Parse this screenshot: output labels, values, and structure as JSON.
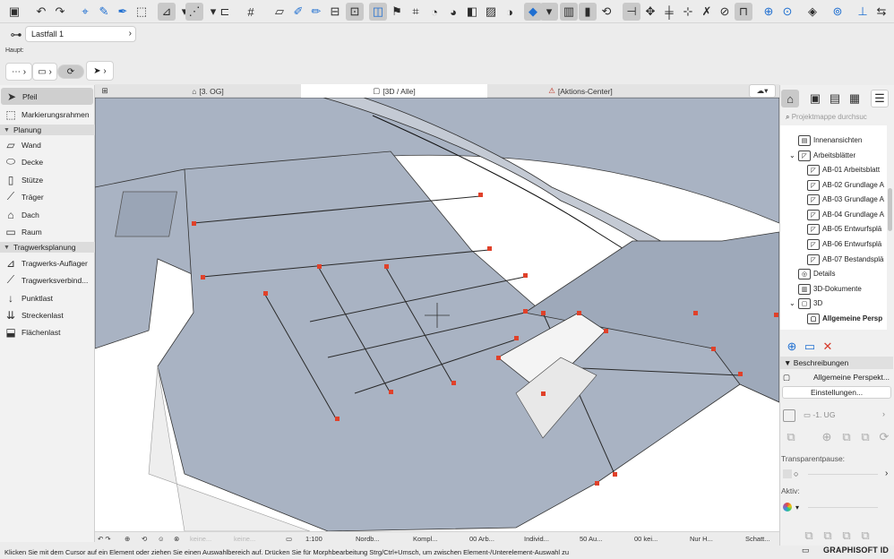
{
  "toolbar": {
    "icons": [
      "save-icon",
      "undo-icon",
      "redo-icon",
      "magic-wand-icon",
      "eyedropper-icon",
      "syringe-icon",
      "lasso-icon",
      "guide-lines-icon",
      "snap-icon",
      "grid-icon",
      "surface-icon",
      "pen-icon",
      "figure-icon",
      "select-box-icon",
      "flag-icon",
      "camera-icon",
      "render-icon",
      "trim-icon",
      "layers-icon",
      "picture-icon",
      "filter-icon",
      "column-icon",
      "view-icon",
      "scale-icon",
      "cut-icon",
      "rotate-icon",
      "mirror-icon",
      "explode-icon",
      "split-icon",
      "zoom-icon",
      "3d-icon",
      "cutaway-icon",
      "dimension-icon"
    ]
  },
  "lastfall": {
    "label": "Lastfall 1",
    "chevron": "›"
  },
  "infobox": {
    "haupt_label": "Haupt:"
  },
  "toolbox": {
    "items": [
      {
        "label": "Pfeil",
        "icon": "arrow-icon",
        "selected": true
      },
      {
        "label": "Markierungsrahmen",
        "icon": "marquee-icon"
      }
    ],
    "groups": [
      {
        "label": "Planung",
        "items": [
          "Wand",
          "Decke",
          "Stütze",
          "Träger",
          "Dach",
          "Raum"
        ]
      },
      {
        "label": "Tragwerksplanung",
        "items": [
          "Tragwerks-Auflager",
          "Tragwerksverbind...",
          "Punktlast",
          "Streckenlast",
          "Flächenlast"
        ]
      }
    ]
  },
  "tabs": [
    {
      "label": "[3. OG]",
      "icon": "floorplan-icon"
    },
    {
      "label": "[3D / Alle]",
      "icon": "3d-window-icon",
      "active": true
    },
    {
      "label": "[Aktions-Center]",
      "icon": "action-center-icon"
    }
  ],
  "statusbar": {
    "items": [
      "keine...",
      "keine...",
      "1:100",
      "Nordb...",
      "Kompl...",
      "00 Arb...",
      "Individ...",
      "50 Au...",
      "00 kei...",
      "Nur H...",
      "Schatt..."
    ]
  },
  "hint": "Klicken Sie mit dem Cursor auf ein Element oder ziehen Sie einen Auswahlbereich auf. Drücken Sie für Morphbearbeitung Strg/Ctrl+Umsch, um zwischen Element-/Unterelement-Auswahl zu",
  "navigator": {
    "search_placeholder": "Projektmappe durchsuc",
    "tree": [
      {
        "label": "Innenansichten",
        "level": 1
      },
      {
        "label": "Arbeitsblätter",
        "level": 1,
        "expanded": true
      },
      {
        "label": "AB-01 Arbeitsblatt",
        "level": 2
      },
      {
        "label": "AB-02 Grundlage A",
        "level": 2
      },
      {
        "label": "AB-03 Grundlage A",
        "level": 2
      },
      {
        "label": "AB-04 Grundlage A",
        "level": 2
      },
      {
        "label": "AB-05 Entwurfsplä",
        "level": 2
      },
      {
        "label": "AB-06 Entwurfsplä",
        "level": 2
      },
      {
        "label": "AB-07 Bestandsplä",
        "level": 2
      },
      {
        "label": "Details",
        "level": 1
      },
      {
        "label": "3D-Dokumente",
        "level": 1
      },
      {
        "label": "3D",
        "level": 1,
        "expanded": true
      },
      {
        "label": "Allgemeine Persp",
        "level": 2,
        "selected": true
      }
    ]
  },
  "properties": {
    "descriptions_header": "Beschreibungen",
    "description_value": "Allgemeine Perspekt...",
    "settings_button": "Einstellungen...",
    "story_value": "-1. UG",
    "transparent_label": "Transparentpause:",
    "active_label": "Aktiv:"
  },
  "brand": "GRAPHISOFT ID",
  "colors": {
    "slab": "#a9b3c3",
    "highlight": "#e0412a",
    "accent": "#1f6fd1"
  }
}
